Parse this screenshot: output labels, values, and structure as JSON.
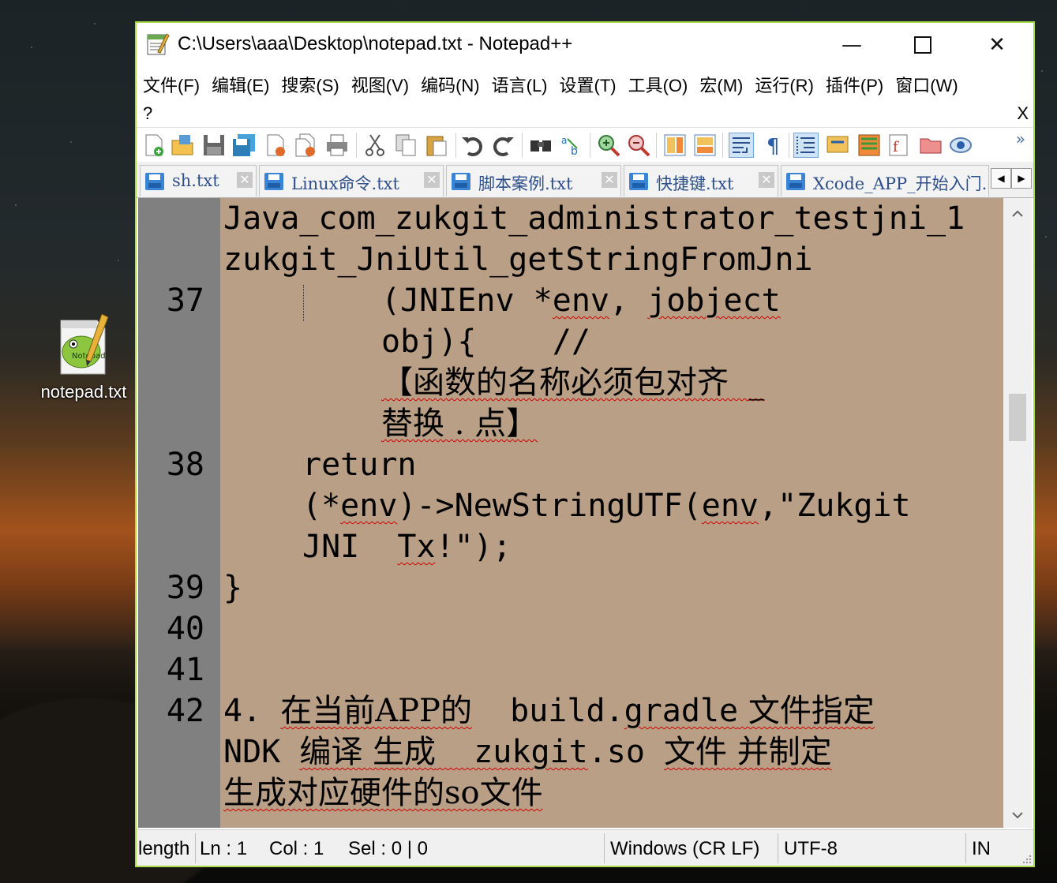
{
  "desktop": {
    "icon_label": "notepad.txt"
  },
  "window": {
    "title": "C:\\Users\\aaa\\Desktop\\notepad.txt - Notepad++",
    "minimize_glyph": "—",
    "maximize_glyph": "☐",
    "close_glyph": "✕"
  },
  "menu": {
    "items": [
      "文件(F)",
      "编辑(E)",
      "搜索(S)",
      "视图(V)",
      "编码(N)",
      "语言(L)",
      "设置(T)",
      "工具(O)",
      "宏(M)",
      "运行(R)",
      "插件(P)",
      "窗口(W)"
    ],
    "help": "?",
    "close_doc": "X"
  },
  "toolbar": {
    "more": "»",
    "icons": [
      "new-file-icon",
      "open-file-icon",
      "save-icon",
      "save-all-icon",
      "close-icon",
      "close-all-icon",
      "print-icon",
      "cut-icon",
      "copy-icon",
      "paste-icon",
      "undo-icon",
      "redo-icon",
      "find-icon",
      "replace-icon",
      "zoom-in-icon",
      "zoom-out-icon",
      "sync-v-icon",
      "sync-h-icon",
      "word-wrap-icon",
      "show-all-chars-icon",
      "indent-guide-icon",
      "user-lang-icon",
      "doc-map-icon",
      "function-list-icon",
      "folder-workspace-icon",
      "monitor-icon"
    ]
  },
  "tabs": [
    {
      "label": "sh.txt",
      "close": "✕"
    },
    {
      "label": "Linux命令.txt",
      "close": "✕"
    },
    {
      "label": "脚本案例.txt",
      "close": "✕"
    },
    {
      "label": "快捷键.txt",
      "close": "✕"
    },
    {
      "label": "Xcode_APP_开始入门.",
      "close": ""
    }
  ],
  "tab_nav": {
    "left": "◀",
    "right": "▶"
  },
  "editor": {
    "line_numbers": [
      "37",
      "38",
      "39",
      "40",
      "41",
      "42"
    ],
    "lines": {
      "l36a": "Java_com_zukgit_administrator_testjni_1",
      "l36b": "zukgit_JniUtil_getStringFromJni",
      "l37a_pre": "(JNIEnv *",
      "l37a_env": "env",
      "l37a_mid": ", ",
      "l37a_job": "jobject",
      "l37b": "obj){    //",
      "l37c": "【函数的名称必须包对齐  _",
      "l37d": "替换 . 点】",
      "l38a": "return",
      "l38b_pre": "(*",
      "l38b_env": "env",
      "l38b_mid": ")->NewStringUTF(",
      "l38b_env2": "env",
      "l38b_str": ",\"Zukgit",
      "l38c_pre": "JNI  ",
      "l38c_tx": "Tx",
      "l38c_end": "!\");",
      "l39": "}",
      "l42a_num": "4. ",
      "l42a_cn1": "在当前APP的",
      "l42a_mid": "  build.",
      "l42a_gradle": "gradle",
      "l42a_cn2": " 文件指定",
      "l42b_ndk": "NDK ",
      "l42b_cn1": "编译 生成",
      "l42b_zuk": "  zukgit",
      "l42b_so": ".so ",
      "l42b_cn2": "文件 并制定",
      "l42c": "生成对应硬件的so文件"
    }
  },
  "statusbar": {
    "length": "length",
    "ln": "Ln : 1",
    "col": "Col : 1",
    "sel": "Sel : 0 | 0",
    "eol": "Windows (CR LF)",
    "encoding": "UTF-8",
    "mode": "IN"
  },
  "colors": {
    "editor_bg": "#b99f86",
    "gutter_bg": "#808080",
    "window_border": "#aadb4a",
    "squiggle": "#d10000"
  }
}
